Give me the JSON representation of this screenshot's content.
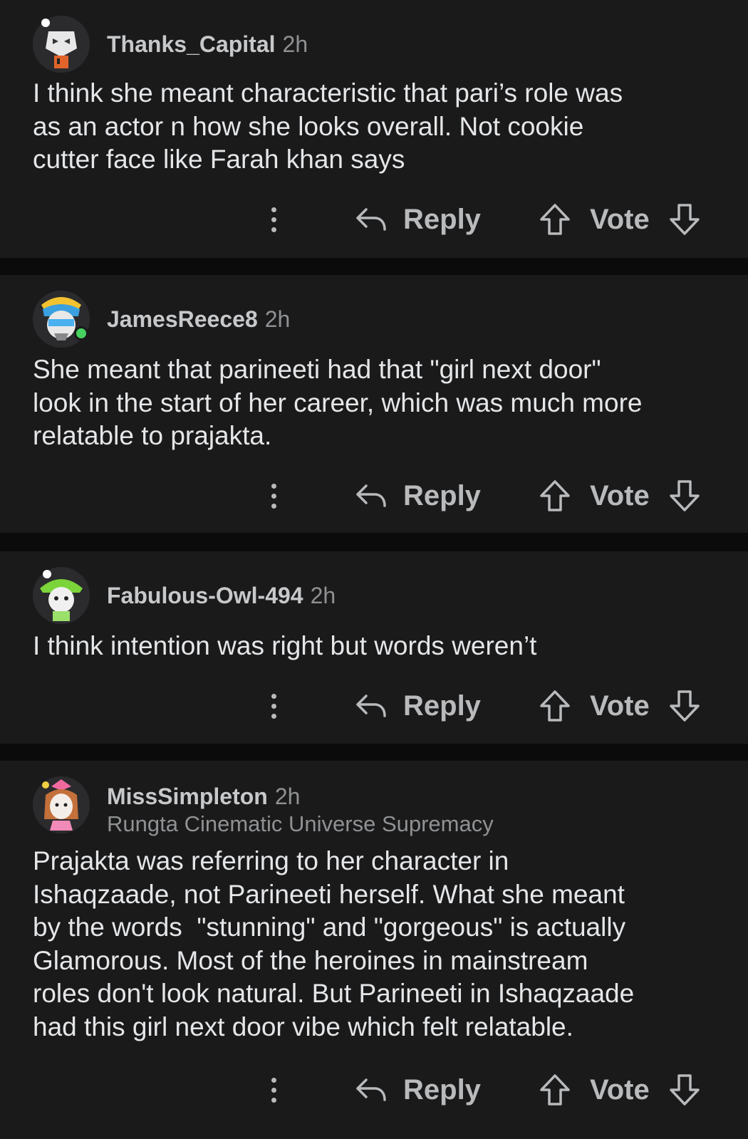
{
  "comments": [
    {
      "username": "Thanks_Capital",
      "time": "2h",
      "body": "I think she meant characteristic that pari’s role was\nas an actor n how she looks overall. Not cookie\ncutter face like Farah khan says",
      "actions": {
        "reply": "Reply",
        "vote": "Vote"
      }
    },
    {
      "username": "JamesReece8",
      "time": "2h",
      "body": "She meant that parineeti had that \"girl next door\"\nlook in the start of her career, which was much more\nrelatable to prajakta.",
      "actions": {
        "reply": "Reply",
        "vote": "Vote"
      }
    },
    {
      "username": "Fabulous-Owl-494",
      "time": "2h",
      "body": "I think intention was right but words weren’t",
      "actions": {
        "reply": "Reply",
        "vote": "Vote"
      }
    },
    {
      "username": "MissSimpleton",
      "time": "2h",
      "flair": "Rungta Cinematic Universe Supremacy",
      "body": "Prajakta was referring to her character in\nIshaqzaade, not Parineeti herself. What she meant\nby the words  \"stunning\" and \"gorgeous\" is actually\nGlamorous. Most of the heroines in mainstream\nroles don't look natural. But Parineeti in Ishaqzaade\nhad this girl next door vibe which felt relatable.",
      "actions": {
        "reply": "Reply",
        "vote": "Vote"
      }
    }
  ],
  "icons": {
    "more": "more-options-icon",
    "reply": "reply-arrow-icon",
    "upvote": "upvote-arrow-icon",
    "downvote": "downvote-arrow-icon"
  },
  "colors": {
    "background": "#0b0b0c",
    "card": "#1a1a1b",
    "online": "#46d160"
  }
}
